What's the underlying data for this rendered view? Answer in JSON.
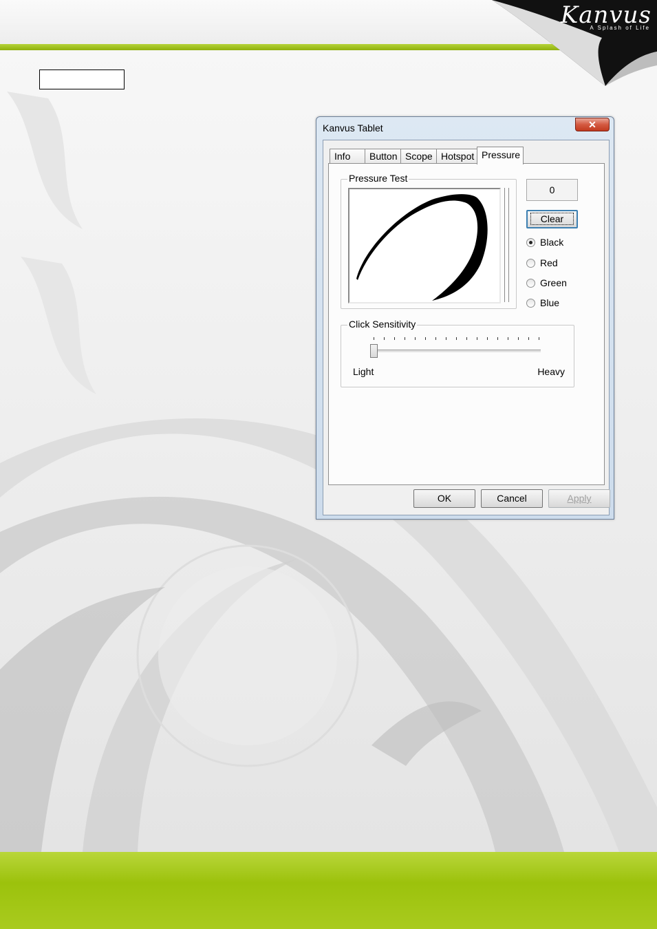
{
  "brand": {
    "logo": "Kanvus",
    "tagline": "A Splash of Life"
  },
  "dialog": {
    "title": "Kanvus Tablet",
    "close_glyph": "✕",
    "tabs": [
      {
        "label": "Info",
        "active": false
      },
      {
        "label": "Button",
        "active": false
      },
      {
        "label": "Scope",
        "active": false
      },
      {
        "label": "Hotspot",
        "active": false
      },
      {
        "label": "Pressure",
        "active": true
      }
    ],
    "pressure_test": {
      "label": "Pressure Test",
      "value": "0",
      "clear_label": "Clear",
      "colors": [
        {
          "label": "Black",
          "checked": true
        },
        {
          "label": "Red",
          "checked": false
        },
        {
          "label": "Green",
          "checked": false
        },
        {
          "label": "Blue",
          "checked": false
        }
      ]
    },
    "click_sensitivity": {
      "label": "Click Sensitivity",
      "min_label": "Light",
      "max_label": "Heavy",
      "level": 0.0
    },
    "buttons": {
      "ok": "OK",
      "cancel": "Cancel",
      "apply": "Apply"
    }
  }
}
